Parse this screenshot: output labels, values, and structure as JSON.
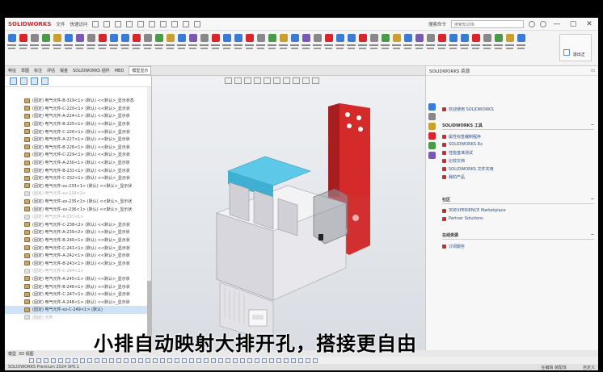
{
  "app": {
    "brand": "SOLIDWORKS",
    "menu_file": "文件",
    "menu_tip": "快速访问",
    "search_placeholder": "搜索命令",
    "search_text": "搜索知识库",
    "right_label": "退出正",
    "window_min": "—",
    "window_max": "▢",
    "window_close": "✕"
  },
  "tabs": {
    "items": [
      "特征",
      "草图",
      "标注",
      "评估",
      "钣金",
      "SOLIDWORKS 插件",
      "MBD",
      "模型显示"
    ],
    "active_index": 7,
    "file": "标注.SLDASM"
  },
  "tree": {
    "rows": [
      {
        "label": "(固定) 电气元件-B-319<1> (默认) <<默认>_显示状态",
        "state": "normal"
      },
      {
        "label": "(固定) 电气元件-C-220<1> (默认) <<默认>_显示状",
        "state": "normal"
      },
      {
        "label": "(固定) 电气元件-A-224<1> (默认) <<默认>_显示状",
        "state": "normal"
      },
      {
        "label": "(固定) 电气元件-B-225<1> (默认) <<默认>_显示状",
        "state": "normal"
      },
      {
        "label": "(固定) 电气元件-C-226<1> (默认) <<默认>_显示状",
        "state": "normal"
      },
      {
        "label": "(固定) 电气元件-A-227<1> (默认) <<默认>_显示状",
        "state": "normal"
      },
      {
        "label": "(固定) 电气元件-B-228<1> (默认) <<默认>_显示状",
        "state": "normal"
      },
      {
        "label": "(固定) 电气元件-C-229<1> (默认) <<默认>_显示状",
        "state": "normal"
      },
      {
        "label": "(固定) 电气元件-A-230<1> (默认) <<默认>_显示状",
        "state": "normal"
      },
      {
        "label": "(固定) 电气元件-B-231<1> (默认) <<默认>_显示状",
        "state": "normal"
      },
      {
        "label": "(固定) 电气元件-C-232<1> (默认) <<默认>_显示状",
        "state": "normal"
      },
      {
        "label": "(固定) 电气元件-xx-233<1> (默认) <<默认>_显示状",
        "state": "normal"
      },
      {
        "label": "(固定) 电气元件-xx-234<1>",
        "state": "grey"
      },
      {
        "label": "(固定) 电气元件-xx-235<1> (默认) <<默认>_显示状",
        "state": "normal"
      },
      {
        "label": "(固定) 电气元件-xx-236<1> (默认) <<默认>_显示状",
        "state": "normal"
      },
      {
        "label": "(固定) 电气元件-A-237<1>",
        "state": "grey"
      },
      {
        "label": "(固定) 电气元件-C-238<2> (默认) <<默认>_显示状",
        "state": "normal"
      },
      {
        "label": "(固定) 电气元件-A-239<2> (默认) <<默认>_显示状",
        "state": "normal"
      },
      {
        "label": "(固定) 电气元件-B-240<1> (默认) <<默认>_显示状",
        "state": "normal"
      },
      {
        "label": "(固定) 电气元件-C-241<1> (默认) <<默认>_显示状",
        "state": "normal"
      },
      {
        "label": "(固定) 电气元件-A-242<1> (默认) <<默认>_显示状",
        "state": "normal"
      },
      {
        "label": "(固定) 电气元件-B-243<1> (默认) <<默认>_显示状",
        "state": "normal"
      },
      {
        "label": "(固定) 电气元件-C-244<1>",
        "state": "grey"
      },
      {
        "label": "(固定) 电气元件-A-245<1> (默认) <<默认>_显示状",
        "state": "normal"
      },
      {
        "label": "(固定) 电气元件-B-246<1> (默认) <<默认>_显示状",
        "state": "normal"
      },
      {
        "label": "(固定) 电气元件-C-247<1> (默认) <<默认>_显示状",
        "state": "normal"
      },
      {
        "label": "(固定) 电气元件-A-248<1> (默认) <<默认>_显示状",
        "state": "normal"
      },
      {
        "label": "(固定) 电气元件-xx-C-249<1> (默认)",
        "state": "selected"
      },
      {
        "label": "(固定) 元件",
        "state": "grey"
      }
    ]
  },
  "pane": {
    "title": "SOLIDWORKS 资源",
    "welcome": "欢迎使用 SOLIDWORKS",
    "tools_header": "SOLIDWORKS 工具",
    "tools": [
      "属性标签编制程序",
      "SOLIDWORKS Rx",
      "性能基准测试",
      "比较文档",
      "SOLIDWORKS 文件实用",
      "我的产品"
    ],
    "community_header": "社区",
    "community": [
      "3DEXPERIENCE Marketplace",
      "Partner Solutions"
    ],
    "online_header": "在线资源",
    "online": [
      "订阅服务"
    ]
  },
  "bottom": {
    "tabs": [
      "模型",
      "3D 视图"
    ],
    "status_left": "SOLIDWORKS Premium 2024 SP0.1",
    "status_mid": "在编辑 装配体",
    "status_right": "自定义"
  },
  "subtitle": "小排自动映射大排开孔，搭接更自由",
  "colors": {
    "accent": "#d8262c",
    "bracket": "#d42a2a",
    "top_face": "#5ec8e8",
    "body": "#e6e6ea"
  }
}
